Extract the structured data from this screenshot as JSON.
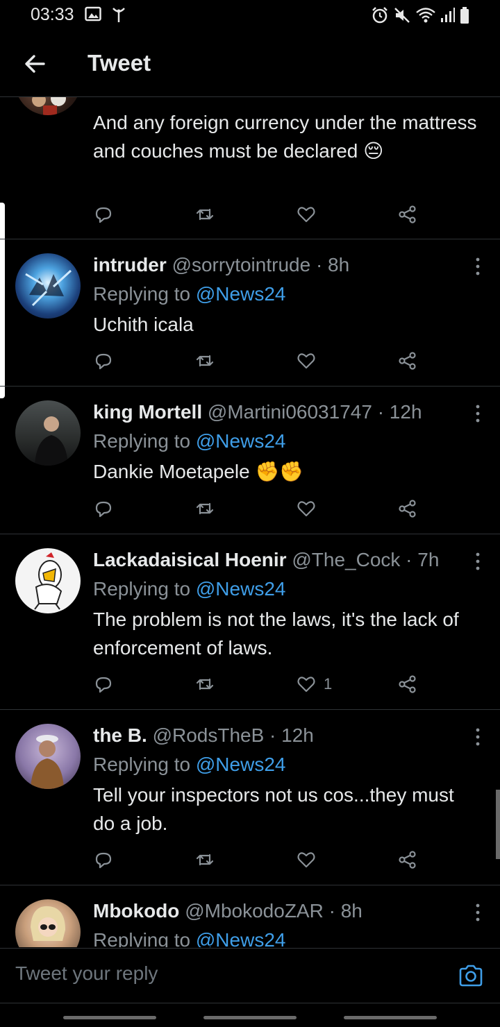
{
  "status_bar": {
    "time": "03:33"
  },
  "header": {
    "title": "Tweet"
  },
  "tweets": [
    {
      "name": "",
      "handle": "",
      "text": "And any foreign currency under the mattress and couches must be declared 😔",
      "likes": ""
    },
    {
      "name": "intruder",
      "handle": "@sorrytointrude · 8h",
      "replying_label": "Replying to",
      "replying_to": "@News24",
      "text": "Uchith icala",
      "likes": ""
    },
    {
      "name": "king Mortell",
      "handle": "@Martini06031747 · 12h",
      "replying_label": "Replying to",
      "replying_to": "@News24",
      "text": "Dankie Moetapele ✊✊",
      "likes": ""
    },
    {
      "name": "Lackadaisical Hoenir",
      "handle": "@The_Cock · 7h",
      "replying_label": "Replying to",
      "replying_to": "@News24",
      "text": "The problem is not the laws, it's the lack of enforcement of laws.",
      "likes": "1"
    },
    {
      "name": "the B.",
      "handle": "@RodsTheB · 12h",
      "replying_label": "Replying to",
      "replying_to": "@News24",
      "text": "Tell your inspectors not us cos...they must do a job.",
      "likes": ""
    },
    {
      "name": "Mbokodo",
      "handle": "@MbokodoZAR · 8h",
      "replying_label": "Replying to",
      "replying_to": "@News24",
      "text": "",
      "likes": ""
    }
  ],
  "reply_bar": {
    "placeholder": "Tweet your reply"
  },
  "colors": {
    "accent": "#3f9ee8",
    "background": "#000000",
    "divider": "#2f3336",
    "muted": "#8b9298"
  }
}
